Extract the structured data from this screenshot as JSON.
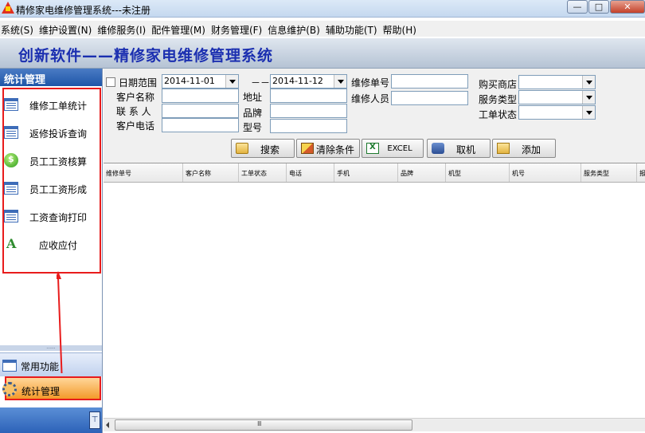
{
  "window": {
    "title": "精修家电维修管理系统---未注册",
    "controls": [
      "—",
      "□",
      "✕"
    ]
  },
  "menu": [
    "系统(S)",
    "维护设置(N)",
    "维修服务(I)",
    "配件管理(M)",
    "财务管理(F)",
    "信息维护(B)",
    "辅助功能(T)",
    "帮助(H)"
  ],
  "banner": {
    "text": "创新软件——精修家电维修管理系统"
  },
  "sidebar": {
    "header": "统计管理",
    "items": [
      {
        "label": "维修工单统计",
        "icon": "report-icon"
      },
      {
        "label": "返修投诉查询",
        "icon": "report-icon"
      },
      {
        "label": "员工工资核算",
        "icon": "money-icon"
      },
      {
        "label": "员工工资形成",
        "icon": "report-icon"
      },
      {
        "label": "工资查询打印",
        "icon": "report-icon"
      },
      {
        "label": "应收应付",
        "icon": "font-icon"
      }
    ],
    "sections": [
      {
        "label": "常用功能",
        "active": false
      },
      {
        "label": "统计管理",
        "active": true
      }
    ],
    "accent_color": "#e81c1c"
  },
  "form": {
    "date_range_label": "日期范围",
    "date_from": "2014-11-01",
    "date_sep": "－－",
    "date_to": "2014-11-12",
    "customer_name_label": "客户名称",
    "contact_label": "联 系 人",
    "customer_phone_label": "客户电话",
    "address_label": "地址",
    "brand_label": "品牌",
    "model_label": "型号",
    "order_no_label": "维修单号",
    "repairer_label": "维修人员",
    "shop_label": "购买商店",
    "service_type_label": "服务类型",
    "order_status_label": "工单状态"
  },
  "buttons": {
    "search": "搜索",
    "clear": "清除条件",
    "excel": "EXCEL",
    "fetch": "取机",
    "add": "添加"
  },
  "grid": {
    "columns": [
      "维修单号",
      "客户名称",
      "工单状态",
      "电话",
      "手机",
      "品牌",
      "机型",
      "机号",
      "服务类型",
      "报"
    ]
  },
  "scrollbar": {
    "grip": "Ⅲ"
  }
}
